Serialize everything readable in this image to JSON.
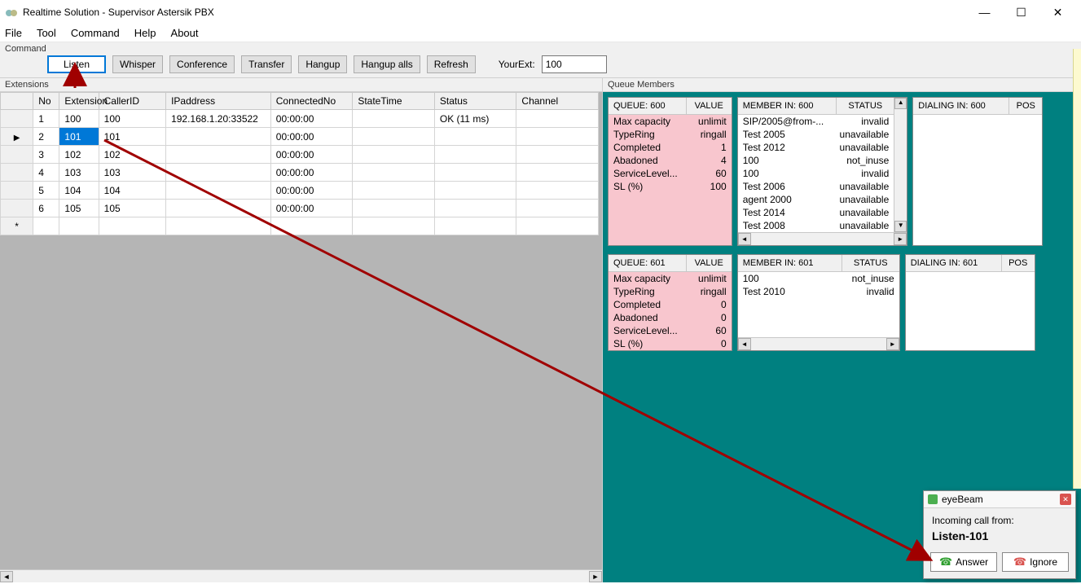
{
  "title": "Realtime Solution - Supervisor Astersik PBX",
  "win": {
    "min": "—",
    "max": "☐",
    "close": "✕"
  },
  "menu": [
    "File",
    "Tool",
    "Command",
    "Help",
    "About"
  ],
  "cmd": {
    "label": "Command",
    "buttons": {
      "listen": "Listen",
      "whisper": "Whisper",
      "conference": "Conference",
      "transfer": "Transfer",
      "hangup": "Hangup",
      "hangupalls": "Hangup alls",
      "refresh": "Refresh"
    },
    "yourext_label": "YourExt:",
    "yourext_value": "100"
  },
  "ext": {
    "label": "Extensions",
    "cols": [
      "No",
      "Extension",
      "CallerID",
      "IPaddress",
      "ConnectedNo",
      "StateTime",
      "Status",
      "Channel"
    ],
    "rows": [
      {
        "no": "1",
        "ext": "100",
        "cid": "100",
        "ip": "192.168.1.20:33522",
        "conn": "00:00:00",
        "stime": "",
        "status": "OK (11 ms)",
        "chan": ""
      },
      {
        "no": "2",
        "ext": "101",
        "cid": "101",
        "ip": "",
        "conn": "00:00:00",
        "stime": "",
        "status": "",
        "chan": ""
      },
      {
        "no": "3",
        "ext": "102",
        "cid": "102",
        "ip": "",
        "conn": "00:00:00",
        "stime": "",
        "status": "",
        "chan": ""
      },
      {
        "no": "4",
        "ext": "103",
        "cid": "103",
        "ip": "",
        "conn": "00:00:00",
        "stime": "",
        "status": "",
        "chan": ""
      },
      {
        "no": "5",
        "ext": "104",
        "cid": "104",
        "ip": "",
        "conn": "00:00:00",
        "stime": "",
        "status": "",
        "chan": ""
      },
      {
        "no": "6",
        "ext": "105",
        "cid": "105",
        "ip": "",
        "conn": "00:00:00",
        "stime": "",
        "status": "",
        "chan": ""
      }
    ],
    "selected_row": 1
  },
  "qm_label": "Queue Members",
  "queues": [
    {
      "qhdr_l": "QUEUE: 600",
      "qhdr_r": "VALUE",
      "stats": [
        [
          "Max capacity",
          "unlimit"
        ],
        [
          "TypeRing",
          "ringall"
        ],
        [
          "Completed",
          "1"
        ],
        [
          "Abadoned",
          "4"
        ],
        [
          "ServiceLevel...",
          "60"
        ],
        [
          "SL (%)",
          "100"
        ]
      ],
      "mhdr_l": "MEMBER IN: 600",
      "mhdr_r": "STATUS",
      "members": [
        [
          "SIP/2005@from-...",
          "invalid"
        ],
        [
          "Test 2005",
          "unavailable"
        ],
        [
          "Test 2012",
          "unavailable"
        ],
        [
          "100",
          "not_inuse"
        ],
        [
          "100",
          "invalid"
        ],
        [
          "Test 2006",
          "unavailable"
        ],
        [
          "agent 2000",
          "unavailable"
        ],
        [
          "Test 2014",
          "unavailable"
        ],
        [
          "Test 2008",
          "unavailable"
        ]
      ],
      "dhdr_l": "DIALING IN: 600",
      "dhdr_r": "POS",
      "dialing": []
    },
    {
      "qhdr_l": "QUEUE: 601",
      "qhdr_r": "VALUE",
      "stats": [
        [
          "Max capacity",
          "unlimit"
        ],
        [
          "TypeRing",
          "ringall"
        ],
        [
          "Completed",
          "0"
        ],
        [
          "Abadoned",
          "0"
        ],
        [
          "ServiceLevel...",
          "60"
        ],
        [
          "SL (%)",
          "0"
        ]
      ],
      "mhdr_l": "MEMBER IN: 601",
      "mhdr_r": "STATUS",
      "members": [
        [
          "100",
          "not_inuse"
        ],
        [
          "Test 2010",
          "invalid"
        ]
      ],
      "dhdr_l": "DIALING IN: 601",
      "dhdr_r": "POS",
      "dialing": []
    }
  ],
  "popup": {
    "title": "eyeBeam",
    "line1": "Incoming call from:",
    "from": "Listen-101",
    "answer": "Answer",
    "ignore": "Ignore"
  }
}
